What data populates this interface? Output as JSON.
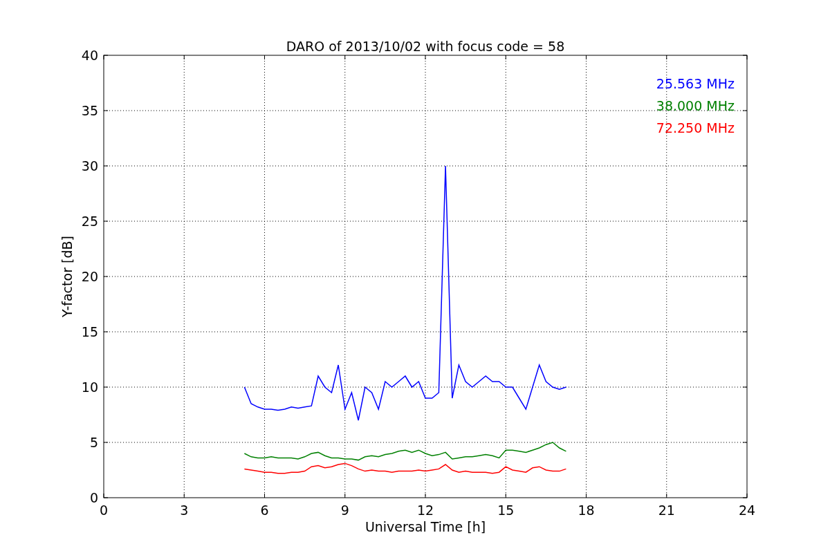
{
  "chart_data": {
    "type": "line",
    "title": "DARO of 2013/10/02 with focus code = 58",
    "xlabel": "Universal Time [h]",
    "ylabel": "Y-factor [dB]",
    "x": [
      5.25,
      5.5,
      5.75,
      6,
      6.25,
      6.5,
      6.75,
      7,
      7.25,
      7.5,
      7.75,
      8,
      8.25,
      8.5,
      8.75,
      9,
      9.25,
      9.5,
      9.75,
      10,
      10.25,
      10.5,
      10.75,
      11,
      11.25,
      11.5,
      11.75,
      12,
      12.25,
      12.5,
      12.75,
      13,
      13.25,
      13.5,
      13.75,
      14,
      14.25,
      14.5,
      14.75,
      15,
      15.25,
      15.5,
      15.75,
      16,
      16.25,
      16.5,
      16.75,
      17,
      17.25
    ],
    "series": [
      {
        "name": "25.563 MHz",
        "color": "#0000ff",
        "values": [
          10,
          8.5,
          8.2,
          8,
          8,
          7.9,
          8,
          8.2,
          8.1,
          8.2,
          8.3,
          11,
          10,
          9.5,
          12,
          8,
          9.5,
          7,
          10,
          9.5,
          8,
          10.5,
          10,
          10.5,
          11,
          10,
          10.5,
          9,
          9,
          9.5,
          30,
          9,
          12,
          10.5,
          10,
          10.5,
          11,
          10.5,
          10.5,
          10,
          10,
          9,
          8,
          10,
          12,
          10.5,
          10,
          9.8,
          10
        ]
      },
      {
        "name": "38.000 MHz",
        "color": "#008000",
        "values": [
          4,
          3.7,
          3.6,
          3.6,
          3.7,
          3.6,
          3.6,
          3.6,
          3.5,
          3.7,
          4,
          4.1,
          3.8,
          3.6,
          3.6,
          3.5,
          3.5,
          3.4,
          3.7,
          3.8,
          3.7,
          3.9,
          4,
          4.2,
          4.3,
          4.1,
          4.3,
          4,
          3.8,
          3.9,
          4.1,
          3.5,
          3.6,
          3.7,
          3.7,
          3.8,
          3.9,
          3.8,
          3.6,
          4.3,
          4.3,
          4.2,
          4.1,
          4.3,
          4.5,
          4.8,
          5,
          4.5,
          4.2
        ]
      },
      {
        "name": "72.250 MHz",
        "color": "#ff0000",
        "values": [
          2.6,
          2.5,
          2.4,
          2.3,
          2.3,
          2.2,
          2.2,
          2.3,
          2.3,
          2.4,
          2.8,
          2.9,
          2.7,
          2.8,
          3,
          3.1,
          2.9,
          2.6,
          2.4,
          2.5,
          2.4,
          2.4,
          2.3,
          2.4,
          2.4,
          2.4,
          2.5,
          2.4,
          2.5,
          2.6,
          3,
          2.5,
          2.3,
          2.4,
          2.3,
          2.3,
          2.3,
          2.2,
          2.3,
          2.8,
          2.5,
          2.4,
          2.3,
          2.7,
          2.8,
          2.5,
          2.4,
          2.4,
          2.6
        ]
      }
    ],
    "grid": true,
    "xlim": [
      0,
      24
    ],
    "ylim": [
      0,
      40
    ],
    "xticks": [
      0,
      3,
      6,
      9,
      12,
      15,
      18,
      21,
      24
    ],
    "yticks": [
      0,
      5,
      10,
      15,
      20,
      25,
      30,
      35,
      40
    ]
  }
}
